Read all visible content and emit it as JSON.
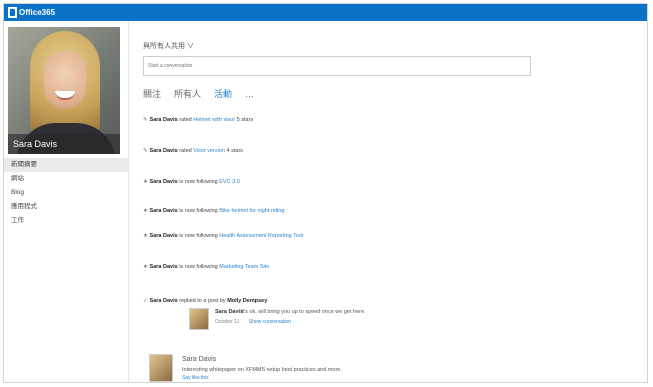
{
  "app": {
    "brand": "Office365"
  },
  "profile": {
    "name": "Sara Davis"
  },
  "sidebar": {
    "items": [
      {
        "label": "新聞摘要"
      },
      {
        "label": "網站"
      },
      {
        "label": "Blog"
      },
      {
        "label": "應用程式"
      },
      {
        "label": "工作"
      }
    ]
  },
  "share": {
    "label": "與所有人共用 ∨",
    "placeholder": "Start a conversation"
  },
  "tabs": [
    {
      "label": "關注"
    },
    {
      "label": "所有人"
    },
    {
      "label": "活動"
    },
    {
      "label": "…"
    }
  ],
  "feed": [
    {
      "icon": "✎",
      "user": "Sara Davis",
      "text": "rated",
      "link": "Helmet with visor",
      "tail": "5 stars"
    },
    {
      "icon": "✎",
      "user": "Sara Davis",
      "text": "rated",
      "link": "Visor version",
      "tail": "4 stars"
    },
    {
      "icon": "★",
      "user": "Sara Davis",
      "text": "is now following",
      "link": "EVC 3.0",
      "tail": ""
    },
    {
      "icon": "★",
      "user": "Sara Davis",
      "text": "is now following",
      "link": "Bike helmet for night riding",
      "tail": ""
    },
    {
      "icon": "★",
      "user": "Sara Davis",
      "text": "is now following",
      "link": "Health Assessment Reporting Tool",
      "tail": ""
    },
    {
      "icon": "★",
      "user": "Sara Davis",
      "text": "is now following",
      "link": "Marketing Team Site",
      "tail": ""
    },
    {
      "icon": "✓",
      "user": "Sara Davis",
      "text": "replied to a post by",
      "link": "Molly Dempsey",
      "tail": ""
    }
  ],
  "reply": {
    "name": "Sara Davis",
    "text": "It's ok, will bring you up to speed once we get here.",
    "date": "October 11",
    "action": "Show conversation"
  },
  "post": {
    "name": "Sara Davis",
    "text": "Interesting whitepaper on XFMMS setup best practices and more.",
    "sub": "Say like this"
  }
}
